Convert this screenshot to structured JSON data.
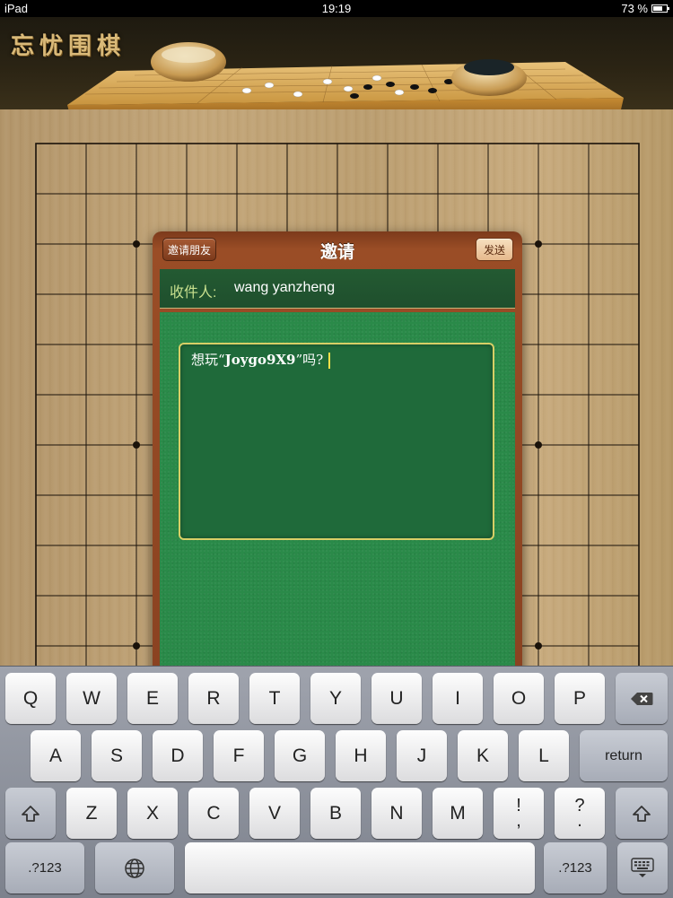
{
  "status_bar": {
    "device": "iPad",
    "time": "19:19",
    "battery": "73 %",
    "battery_level": 0.73
  },
  "header": {
    "app_title": "忘忧围棋"
  },
  "dialog": {
    "back_label": "邀请朋友",
    "title": "邀请",
    "send_label": "发送",
    "recipient_label": "收件人:",
    "recipient_value": "wang yanzheng",
    "message_prefix": "想玩“",
    "message_game": "Joygo9X9",
    "message_suffix": "”吗?"
  },
  "keyboard": {
    "row1": [
      "Q",
      "W",
      "E",
      "R",
      "T",
      "Y",
      "U",
      "I",
      "O",
      "P"
    ],
    "row2": [
      "A",
      "S",
      "D",
      "F",
      "G",
      "H",
      "J",
      "K",
      "L"
    ],
    "row3": [
      "Z",
      "X",
      "C",
      "V",
      "B",
      "N",
      "M"
    ],
    "punct1": {
      "top": "!",
      "bottom": ","
    },
    "punct2": {
      "top": "?",
      "bottom": "."
    },
    "return_label": "return",
    "numbers_label": ".?123",
    "icons": {
      "delete": "backspace-icon",
      "shift": "shift-icon",
      "globe": "globe-icon",
      "dismiss": "keyboard-dismiss-icon"
    }
  }
}
